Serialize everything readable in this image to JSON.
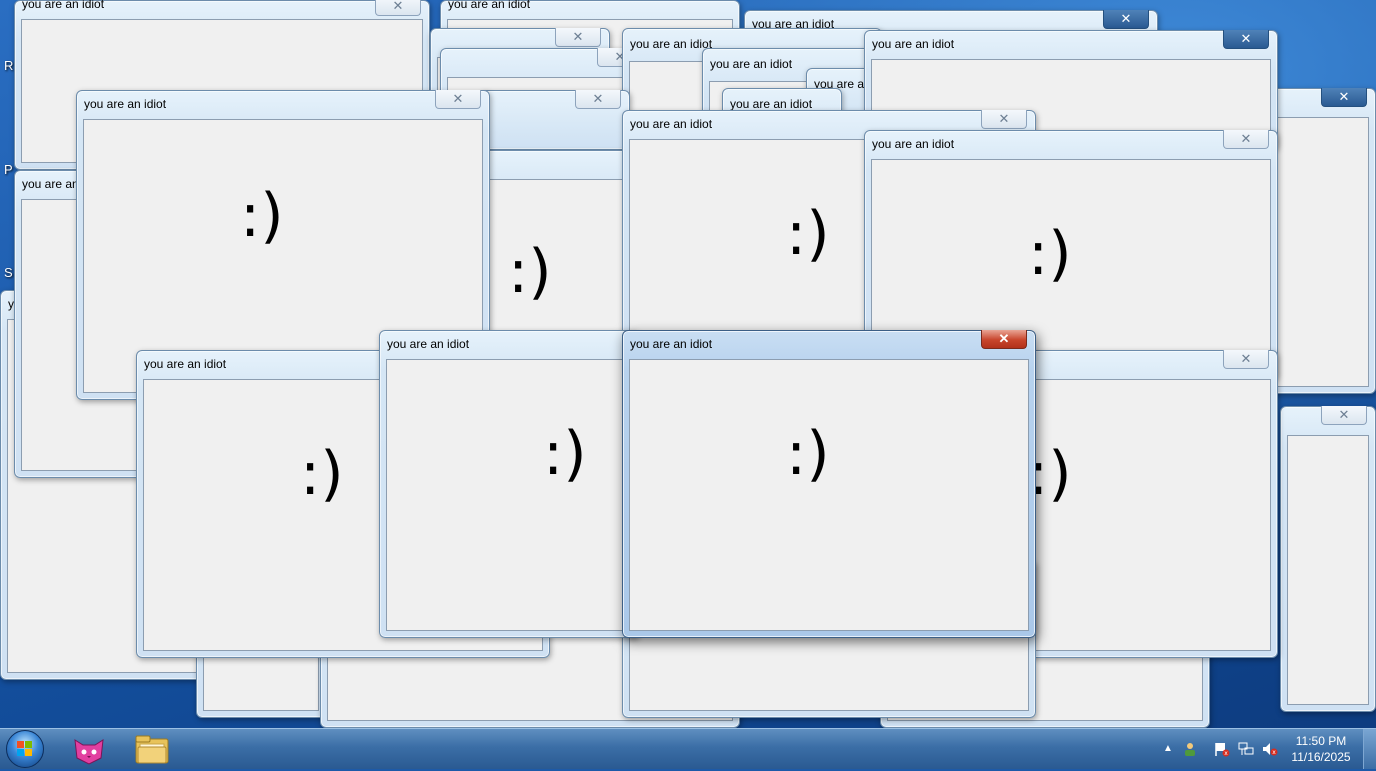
{
  "windows": [
    {
      "title": "you are an idiot",
      "smiley": ":)",
      "close": "✕"
    }
  ],
  "desktop": {
    "icon_labels": [
      "R",
      "P",
      "S"
    ]
  },
  "taskbar": {
    "pinned": [
      "start-button",
      "cat-app-icon",
      "file-explorer-icon"
    ],
    "tray": {
      "show_hidden": "▲",
      "time": "11:50 PM",
      "date": "11/16/2025"
    }
  },
  "colors": {
    "desktop_blue": "#1d5aa8",
    "window_frame": "#d5e6f5",
    "client": "#f0f0f0",
    "close_active": "#c8452c"
  }
}
